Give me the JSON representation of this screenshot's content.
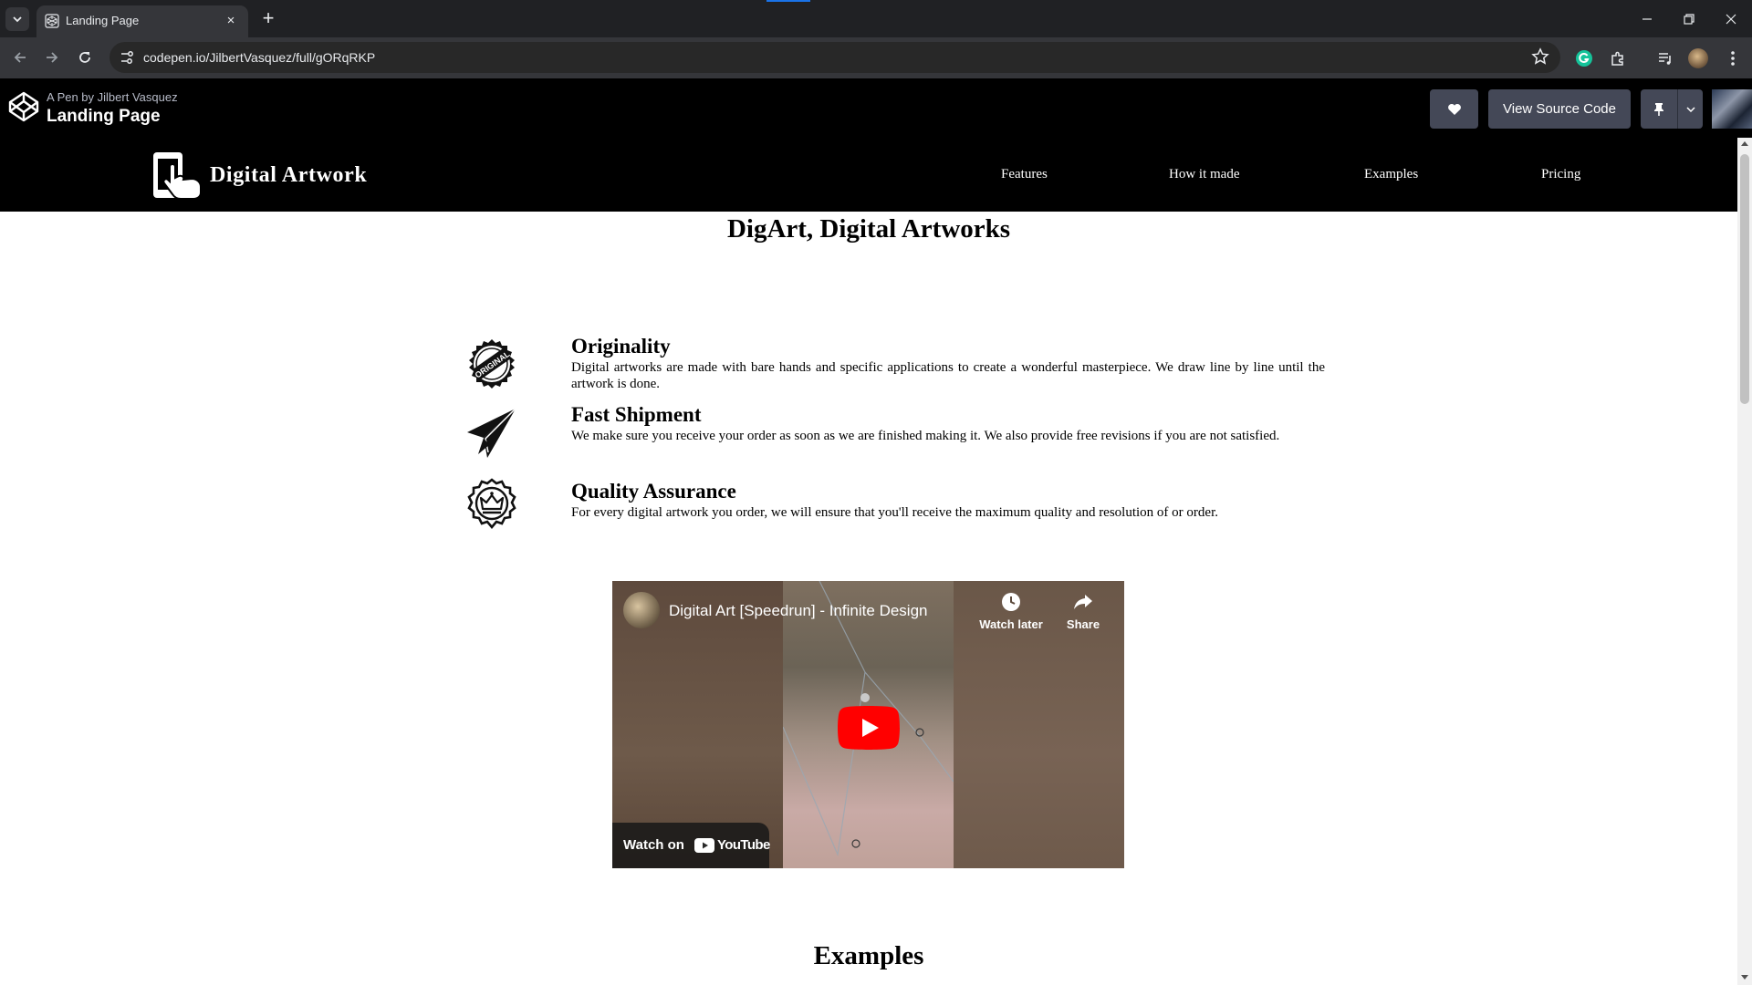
{
  "browser": {
    "tab_title": "Landing Page",
    "tab_close_label": "×",
    "new_tab_label": "+",
    "url": "codepen.io/JilbertVasquez/full/gORqRKP"
  },
  "codepen": {
    "byline": "A Pen by Jilbert Vasquez",
    "title": "Landing Page",
    "view_source_label": "View Source Code"
  },
  "site": {
    "brand": "Digital Artwork",
    "nav": [
      "Features",
      "How it made",
      "Examples",
      "Pricing"
    ],
    "hero_title": "DigArt, Digital Artworks",
    "features": [
      {
        "icon": "original-stamp-icon",
        "title": "Originality",
        "desc": "Digital artworks are made with bare hands and specific applications to create a wonderful masterpiece. We draw line by line until the artwork is done."
      },
      {
        "icon": "paper-plane-icon",
        "title": "Fast Shipment",
        "desc": "We make sure you receive your order as soon as we are finished making it. We also provide free revisions if you are not satisfied."
      },
      {
        "icon": "quality-badge-icon",
        "title": "Quality Assurance",
        "desc": "For every digital artwork you order, we will ensure that you'll receive the maximum quality and resolution of or order."
      }
    ],
    "video": {
      "title": "Digital Art [Speedrun] - Infinite Design",
      "watch_later": "Watch later",
      "share": "Share",
      "watch_on": "Watch on",
      "youtube": "YouTube"
    },
    "examples_title": "Examples"
  },
  "colors": {
    "browser_bg": "#202124",
    "toolbar_bg": "#35363a",
    "codepen_button": "#444857",
    "page_nav_bg": "#000000",
    "youtube_red": "#ff0000"
  }
}
